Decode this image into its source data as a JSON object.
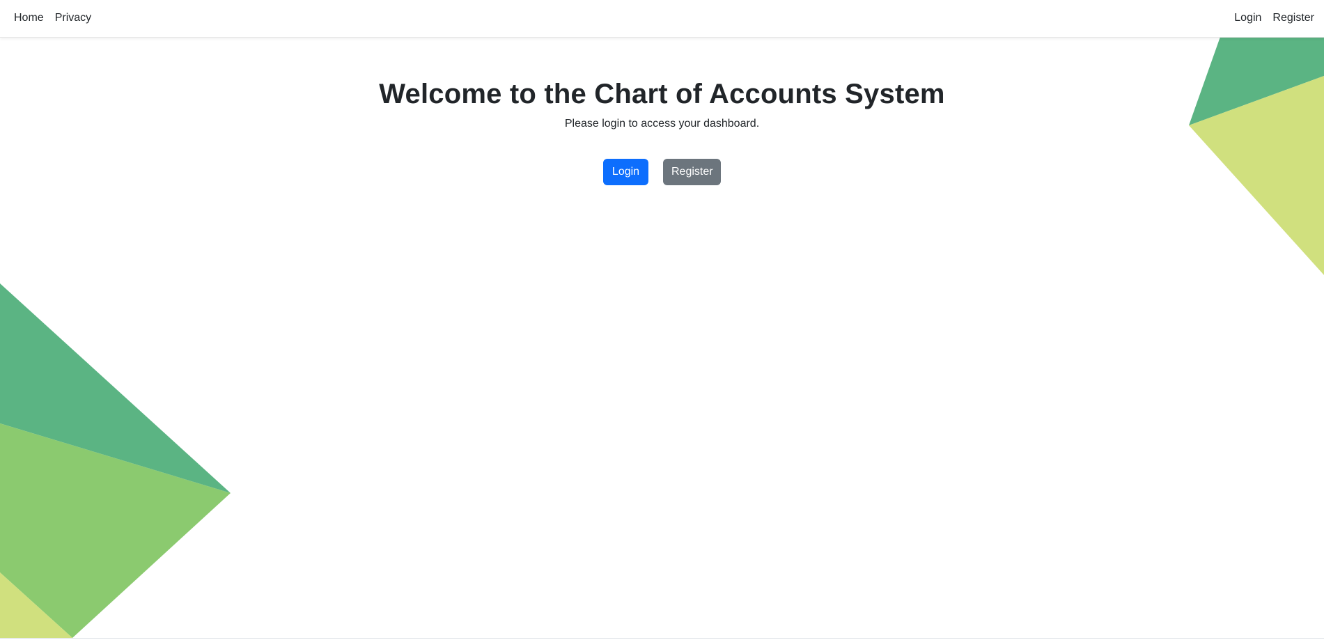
{
  "nav": {
    "left": [
      {
        "label": "Home"
      },
      {
        "label": "Privacy"
      }
    ],
    "right": [
      {
        "label": "Login"
      },
      {
        "label": "Register"
      }
    ]
  },
  "hero": {
    "title": "Welcome to the Chart of Accounts System",
    "subtitle": "Please login to access your dashboard.",
    "login_label": "Login",
    "register_label": "Register"
  },
  "colors": {
    "primary": "#0d6efd",
    "secondary": "#6c757d",
    "shape_dark_green": "#5bb483",
    "shape_mid_green": "#8bca6f",
    "shape_light_green": "#d0e07e"
  }
}
